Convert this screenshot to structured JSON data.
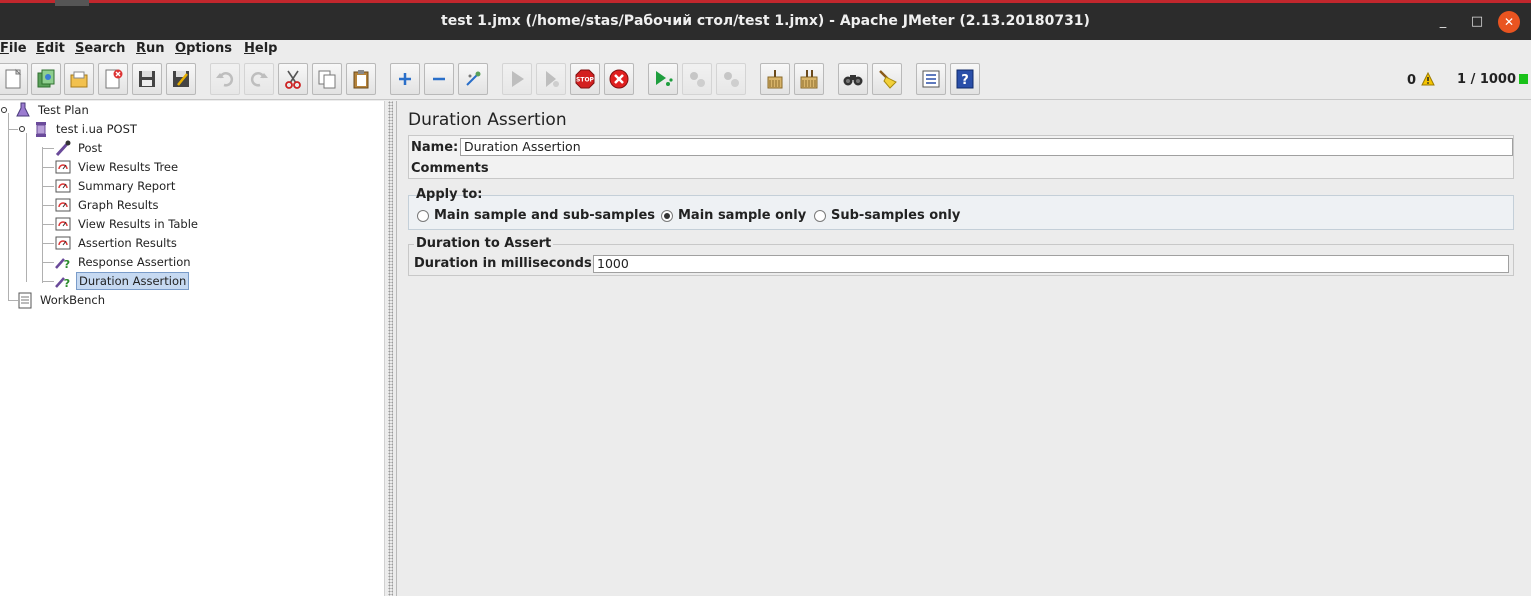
{
  "window": {
    "title": "test 1.jmx (/home/stas/Рабочий стол/test 1.jmx) - Apache JMeter (2.13.20180731)",
    "minimize": "_",
    "maximize": "□",
    "close": "✕"
  },
  "menu": [
    "File",
    "Edit",
    "Search",
    "Run",
    "Options",
    "Help"
  ],
  "toolbar": {
    "buttons": [
      "new",
      "templates",
      "open",
      "close",
      "save",
      "save-as",
      "undo",
      "redo",
      "cut",
      "copy",
      "paste",
      "expand",
      "collapse",
      "toggle",
      "start",
      "start-no-pauses",
      "stop",
      "shutdown",
      "remote-start",
      "remote-stop",
      "remote-exit",
      "clear",
      "clear-all",
      "search",
      "reset-search",
      "function-helper",
      "help"
    ],
    "warnings": "0",
    "threads": "1 / 1000",
    "running_color": "#19c219"
  },
  "tree": {
    "root": "Test Plan",
    "thread_group": "test i.ua POST",
    "children": [
      "Post",
      "View Results Tree",
      "Summary Report",
      "Graph Results",
      "View Results in Table",
      "Assertion Results",
      "Response Assertion",
      "Duration Assertion"
    ],
    "selected": "Duration Assertion",
    "workbench": "WorkBench"
  },
  "panel": {
    "title": "Duration Assertion",
    "name_label": "Name:",
    "name_value": "Duration Assertion",
    "comments_label": "Comments:",
    "apply_to": {
      "label": "Apply to:",
      "options": [
        "Main sample and sub-samples",
        "Main sample only",
        "Sub-samples only"
      ],
      "selected": "Main sample only"
    },
    "duration": {
      "group_label": "Duration to Assert",
      "field_label": "Duration in milliseconds:",
      "value": "1000"
    }
  }
}
